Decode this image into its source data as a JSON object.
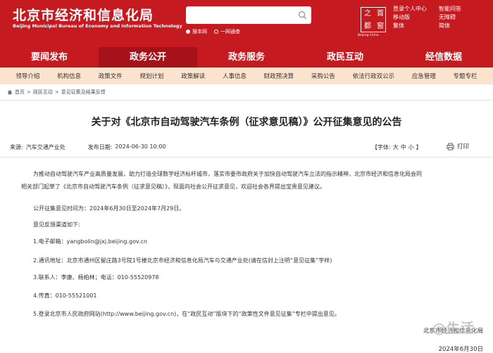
{
  "header": {
    "title": "北京市经济和信息化局",
    "subtitle": "Beijing Municipal Bureau of Economy and Information Technology",
    "search": {
      "placeholder": "",
      "scope_site": "搜本网",
      "scope_all": "一网通查"
    },
    "logo": {
      "chars": [
        "之",
        "首",
        "都",
        "窗"
      ],
      "caption": "Beijing·China"
    },
    "utility_left": [
      "登录个人中心",
      "移动版",
      "繁体"
    ],
    "utility_right": [
      "智能问答",
      "无障碍",
      "简体"
    ]
  },
  "main_nav": [
    "要闻发布",
    "政务公开",
    "政务服务",
    "政民互动",
    "经信数据"
  ],
  "main_nav_active": "政务公开",
  "sub_nav": [
    "领导介绍",
    "机构信息",
    "政策文件",
    "规划计划",
    "政策解读",
    "人事信息",
    "财政预决算",
    "采购公告",
    "依法行政双公示",
    "应急管理",
    "专题专栏"
  ],
  "breadcrumb": [
    "首页",
    "政民互动",
    "意见征集及结果反馈"
  ],
  "article": {
    "title": "关于对《北京市自动驾驶汽车条例（征求意见稿）》公开征集意见的公告",
    "source_label": "来源:",
    "source_value": "汽车交通产业处",
    "date_label": "发布日期:",
    "date_value": "2024-06-30 10:00",
    "font_label": "【字体:",
    "font_sizes": [
      "大",
      "中",
      "小"
    ],
    "font_close": "】",
    "print_label": "打印",
    "paragraphs": [
      "为推动自动驾驶汽车产业高质量发展，助力打造全球数字经济标杆城市，落实市委市政府关于加快自动驾驶汽车立法的指示精神，北京市经济和信息化局会同",
      "相关部门起草了《北京市自动驾驶汽车条例（征求意见稿）》，现面向社会公开征求意见，欢迎社会各界提出宝贵意见建议。",
      "公开征集意见时间为：2024年6月30日至2024年7月29日。",
      "意见反馈渠道如下:",
      "1.电子邮箱：yangbolin@jxj.beijing.gov.cn",
      "2.通讯地址：北京市通州区留庄路3号院1号楼北京市经济和信息化局汽车与交通产业处(请在信封上注明“意见征集”字样)",
      "3.联系人：李康、杨柏林；电话：010-55520978",
      "4.传真：010-55521001",
      "5.登录北京市人民政府网站(http://www.beijing.gov.cn)，在“政民互动”版块下的“政策性文件意见征集”专栏中提出意见。"
    ],
    "sign_org": "北京市经济和信息化局",
    "sign_date": "2024年6月30日"
  },
  "watermark": "@生活",
  "colors": {
    "brand_red": "#c41a20",
    "active_nav": "#a5121a",
    "subnav_bg": "#fbe3cd"
  }
}
